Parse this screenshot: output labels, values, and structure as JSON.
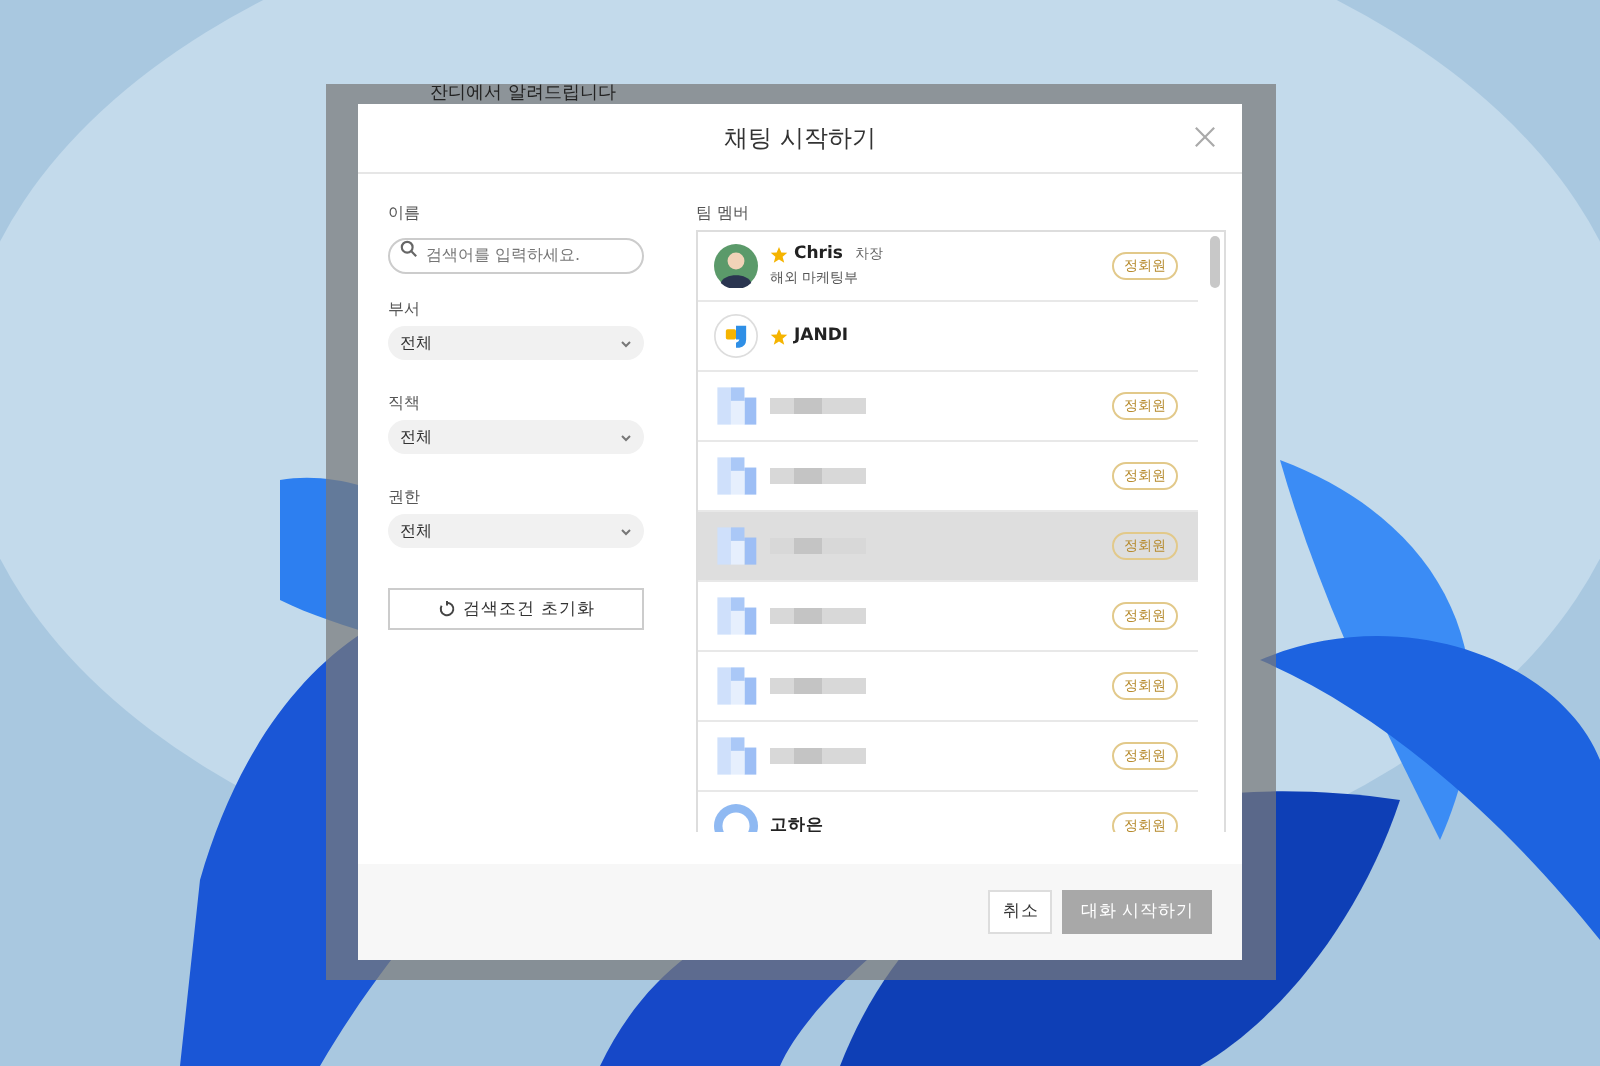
{
  "background_app": {
    "notice": "잔디에서 알려드립니다"
  },
  "dialog": {
    "title": "채팅 시작하기"
  },
  "filters": {
    "name_label": "이름",
    "search": {
      "placeholder": "검색어를 입력하세요."
    },
    "selects": [
      {
        "label": "부서",
        "value": "전체"
      },
      {
        "label": "직책",
        "value": "전체"
      },
      {
        "label": "권한",
        "value": "전체"
      }
    ],
    "reset_button": "검색조건 초기화"
  },
  "members_label": "팀 멤버",
  "members": [
    {
      "kind": "person",
      "starred": true,
      "name": "Chris",
      "position": "차장",
      "department": "해외 마케팅부",
      "badge": "정회원",
      "highlighted": false
    },
    {
      "kind": "bot",
      "starred": true,
      "name": "JANDI",
      "highlighted": false
    },
    {
      "kind": "hidden",
      "badge": "정회원",
      "highlighted": false
    },
    {
      "kind": "hidden",
      "badge": "정회원",
      "highlighted": false
    },
    {
      "kind": "hidden",
      "badge": "정회원",
      "highlighted": true
    },
    {
      "kind": "hidden",
      "badge": "정회원",
      "highlighted": false
    },
    {
      "kind": "hidden",
      "badge": "정회원",
      "highlighted": false
    },
    {
      "kind": "hidden",
      "badge": "정회원",
      "highlighted": false
    },
    {
      "kind": "plain",
      "starred": false,
      "name": "고하은",
      "badge": "정회원",
      "highlighted": false
    }
  ],
  "buttons": [
    {
      "label": "취소",
      "disabled": false
    },
    {
      "label": "대화 시작하기",
      "disabled": true
    }
  ]
}
